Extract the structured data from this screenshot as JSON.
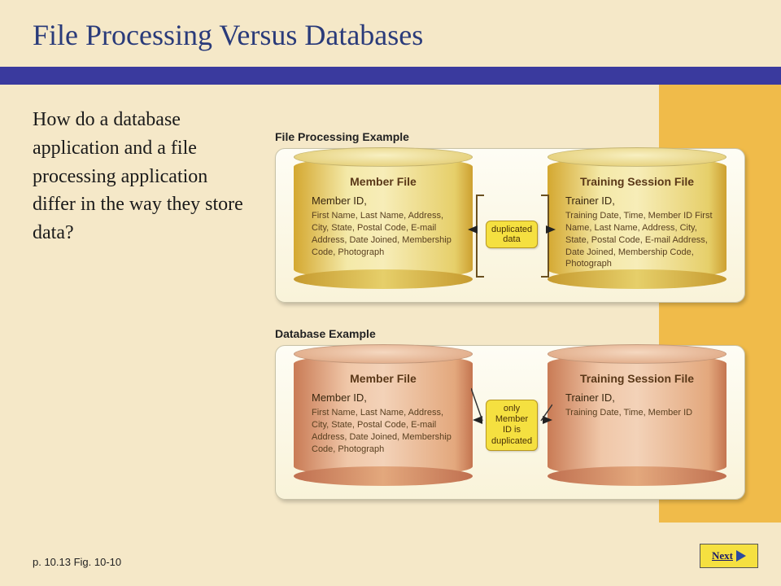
{
  "title": "File Processing Versus Databases",
  "question": "How do a database application and a file processing application differ in the way they store data?",
  "sections": {
    "file_processing": {
      "label": "File Processing Example",
      "left": {
        "title": "Member File",
        "key": "Member ID,",
        "fields": "First Name, Last Name, Address, City, State, Postal Code, E-mail Address, Date Joined, Membership Code, Photograph"
      },
      "right": {
        "title": "Training Session File",
        "key": "Trainer ID,",
        "fields": "Training Date, Time, Member ID First Name, Last Name, Address, City, State, Postal Code, E-mail Address, Date Joined, Membership Code, Photograph"
      },
      "badge": "duplicated data"
    },
    "database": {
      "label": "Database Example",
      "left": {
        "title": "Member File",
        "key": "Member ID,",
        "fields": "First Name, Last Name, Address, City, State, Postal Code, E-mail Address, Date Joined, Membership Code, Photograph"
      },
      "right": {
        "title": "Training Session File",
        "key": "Trainer ID,",
        "fields": "Training Date, Time, Member ID"
      },
      "badge": "only Member ID is duplicated"
    }
  },
  "footer": "p. 10.13 Fig. 10-10",
  "next_label": "Next",
  "colors": {
    "purple": "#3a3a9e",
    "orange": "#f0bb4a",
    "cream": "#f5e8c8",
    "badge": "#f5e040"
  }
}
